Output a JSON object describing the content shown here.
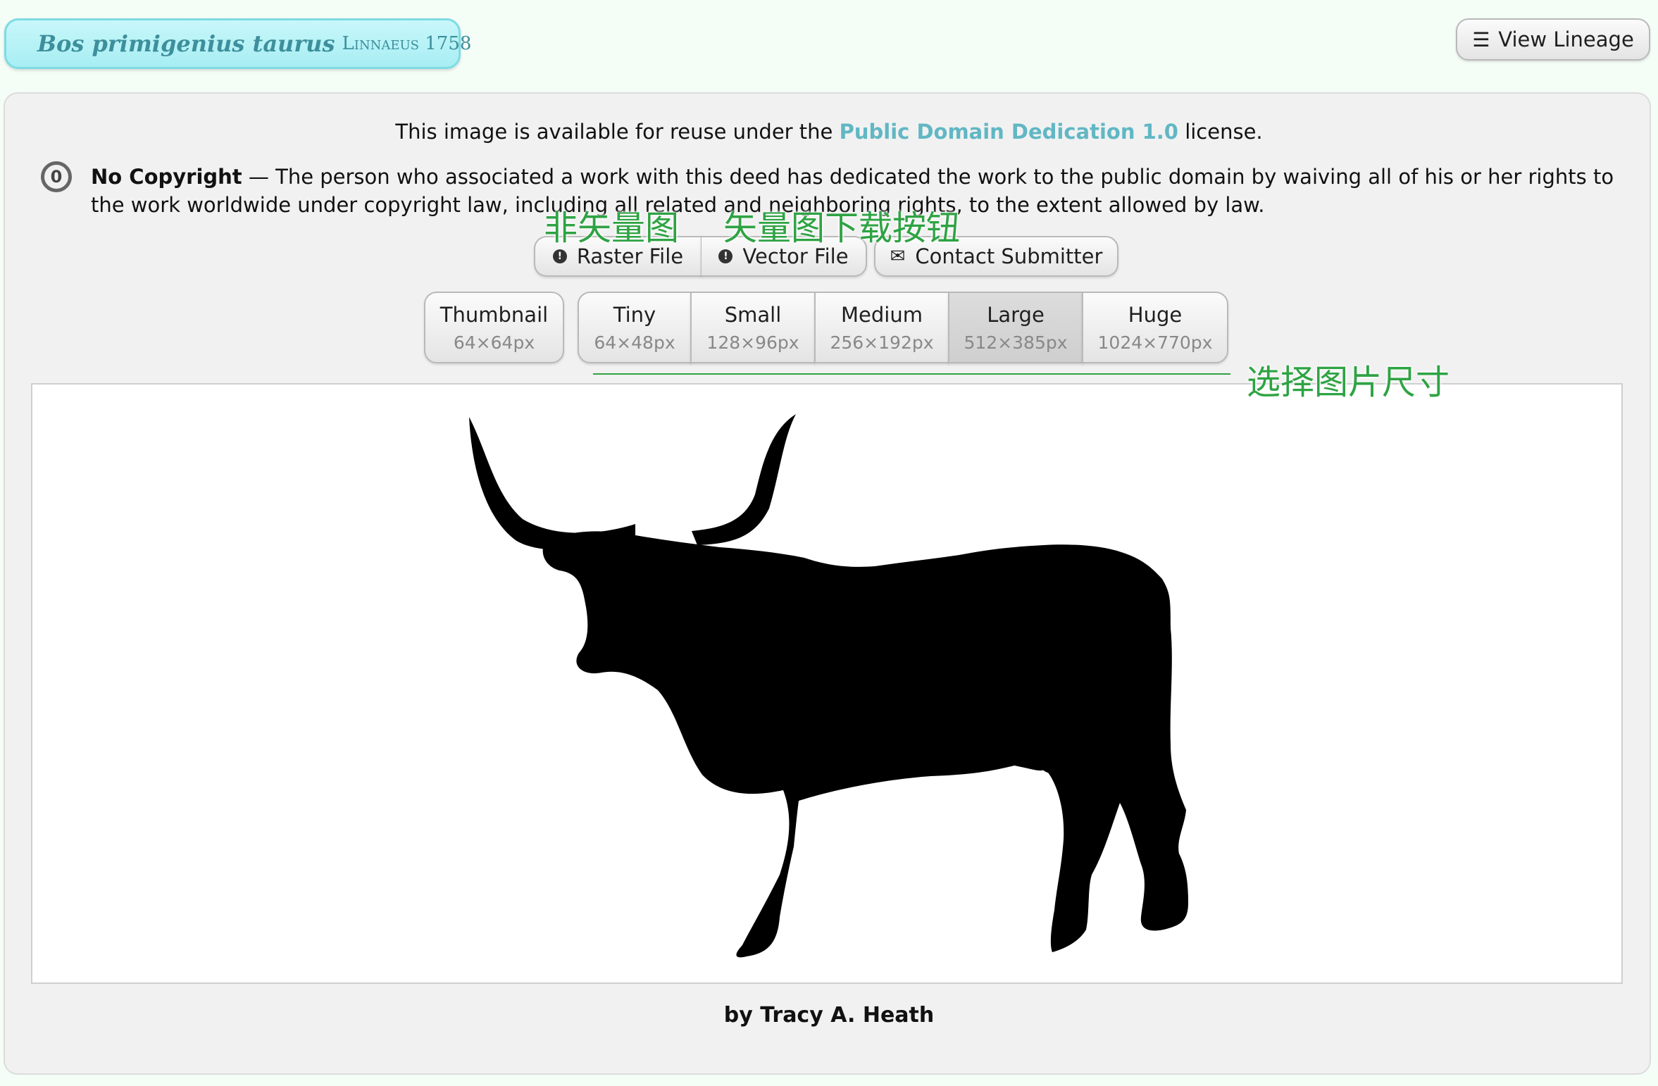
{
  "header": {
    "scientific_name": "Bos primigenius taurus",
    "authority": "Linnaeus 1758",
    "lineage_button": "View Lineage",
    "lineage_icon": "list-icon"
  },
  "license": {
    "prefix": "This image is available for reuse under the",
    "link_text": "Public Domain Dedication 1.0",
    "suffix": "license.",
    "heading": "No Copyright",
    "body": " — The person who associated a work with this deed has dedicated the work to the public domain by waiving all of his or her rights to the work worldwide under copyright law, including all related and neighboring rights, to the extent allowed by law.",
    "icon": "cc-zero-icon",
    "link_color": "#61b7c4"
  },
  "downloads": {
    "raster": "Raster File",
    "vector": "Vector File",
    "contact": "Contact Submitter",
    "download_icon": "download-icon",
    "mail_icon": "mail-icon"
  },
  "sizes": [
    {
      "name": "Thumbnail",
      "dims": "64×64px"
    },
    {
      "name": "Tiny",
      "dims": "64×48px"
    },
    {
      "name": "Small",
      "dims": "128×96px"
    },
    {
      "name": "Medium",
      "dims": "256×192px"
    },
    {
      "name": "Large",
      "dims": "512×385px",
      "selected": true
    },
    {
      "name": "Huge",
      "dims": "1024×770px"
    }
  ],
  "image": {
    "subject": "bull-silhouette"
  },
  "credit": "by Tracy A. Heath",
  "annotations": {
    "raster_note": "非矢量图",
    "vector_note": "矢量图下载按钮",
    "size_note": "选择图片尺寸",
    "color": "#2ea343"
  }
}
